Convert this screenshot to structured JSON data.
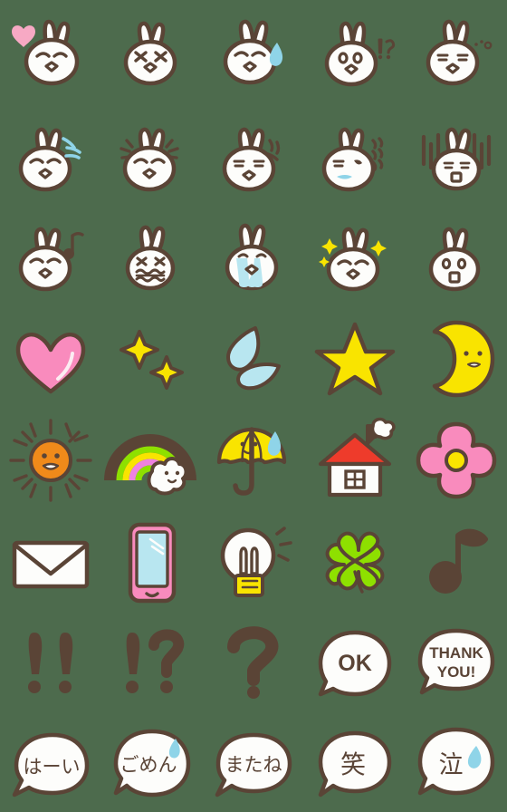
{
  "sheet": {
    "title": "Rabbit Emoji Sticker Sheet",
    "background_color": "#4d6b4d",
    "columns": 5,
    "rows": 8,
    "palette": {
      "outline": "#5a4436",
      "white": "#fdfdfb",
      "pink": "#f98bbd",
      "light_pink": "#f7a9c4",
      "yellow": "#f9e400",
      "light_blue": "#b8e6f0",
      "blue": "#8fd4e8",
      "orange": "#f08a1a",
      "red": "#ee3b2b",
      "green": "#8ee000",
      "brown": "#5a4436",
      "magenta": "#ee82e0"
    },
    "items": [
      {
        "id": "rabbit-heart",
        "label": "rabbit with heart",
        "row": 1,
        "col": 1
      },
      {
        "id": "rabbit-squint",
        "label": "rabbit squinting happy",
        "row": 1,
        "col": 2
      },
      {
        "id": "rabbit-sweat",
        "label": "rabbit with sweat drop",
        "row": 1,
        "col": 3
      },
      {
        "id": "rabbit-surprised",
        "label": "rabbit surprised",
        "row": 1,
        "col": 4,
        "mark": "!?"
      },
      {
        "id": "rabbit-sleepy",
        "label": "rabbit sleepy",
        "row": 1,
        "col": 5
      },
      {
        "id": "rabbit-splash",
        "label": "rabbit with splash",
        "row": 2,
        "col": 1
      },
      {
        "id": "rabbit-excited",
        "label": "rabbit excited lines",
        "row": 2,
        "col": 2
      },
      {
        "id": "rabbit-sparkle-side",
        "label": "rabbit with sparkles",
        "row": 2,
        "col": 3
      },
      {
        "id": "rabbit-shout",
        "label": "rabbit shouting",
        "row": 2,
        "col": 4
      },
      {
        "id": "rabbit-shock",
        "label": "rabbit shocked bars",
        "row": 2,
        "col": 5
      },
      {
        "id": "rabbit-note",
        "label": "rabbit with music note",
        "row": 3,
        "col": 1
      },
      {
        "id": "rabbit-gritted",
        "label": "rabbit gritted teeth",
        "row": 3,
        "col": 2
      },
      {
        "id": "rabbit-crying",
        "label": "rabbit crying tears",
        "row": 3,
        "col": 3
      },
      {
        "id": "rabbit-sparkly-joy",
        "label": "rabbit sparkling joy",
        "row": 3,
        "col": 4
      },
      {
        "id": "rabbit-gasp",
        "label": "rabbit gasping",
        "row": 3,
        "col": 5
      },
      {
        "id": "heart",
        "label": "pink heart",
        "row": 4,
        "col": 1
      },
      {
        "id": "sparkles",
        "label": "yellow sparkles",
        "row": 4,
        "col": 2
      },
      {
        "id": "water-drops",
        "label": "blue water drops",
        "row": 4,
        "col": 3
      },
      {
        "id": "star",
        "label": "yellow star",
        "row": 4,
        "col": 4
      },
      {
        "id": "moon",
        "label": "crescent moon face",
        "row": 4,
        "col": 5
      },
      {
        "id": "sun",
        "label": "orange sun face",
        "row": 5,
        "col": 1
      },
      {
        "id": "rainbow",
        "label": "rainbow with cloud",
        "row": 5,
        "col": 2
      },
      {
        "id": "umbrella",
        "label": "yellow umbrella face",
        "row": 5,
        "col": 3
      },
      {
        "id": "house",
        "label": "house with chimney smoke",
        "row": 5,
        "col": 4
      },
      {
        "id": "flower",
        "label": "pink flower",
        "row": 5,
        "col": 5
      },
      {
        "id": "envelope",
        "label": "white envelope",
        "row": 6,
        "col": 1
      },
      {
        "id": "smartphone",
        "label": "pink smartphone",
        "row": 6,
        "col": 2
      },
      {
        "id": "lightbulb-rabbit",
        "label": "rabbit light bulb idea",
        "row": 6,
        "col": 3
      },
      {
        "id": "clover",
        "label": "four leaf clover",
        "row": 6,
        "col": 4
      },
      {
        "id": "music-note",
        "label": "brown music note",
        "row": 6,
        "col": 5
      },
      {
        "id": "double-exclamation",
        "label": "double exclamation mark",
        "row": 7,
        "col": 1,
        "mark": "!!"
      },
      {
        "id": "interrobang",
        "label": "exclamation question mark",
        "row": 7,
        "col": 2,
        "mark": "!?"
      },
      {
        "id": "question-mark",
        "label": "question mark",
        "row": 7,
        "col": 3,
        "mark": "?"
      },
      {
        "id": "bubble-ok",
        "label": "speech bubble OK",
        "row": 7,
        "col": 4,
        "text": "OK"
      },
      {
        "id": "bubble-thankyou",
        "label": "speech bubble thank you",
        "row": 7,
        "col": 5,
        "text": "THANK YOU!",
        "line1": "THANK",
        "line2": "YOU!"
      },
      {
        "id": "bubble-hai",
        "label": "speech bubble hai",
        "row": 8,
        "col": 1,
        "text": "はーい"
      },
      {
        "id": "bubble-gomen",
        "label": "speech bubble gomen",
        "row": 8,
        "col": 2,
        "text": "ごめん"
      },
      {
        "id": "bubble-matane",
        "label": "speech bubble matane",
        "row": 8,
        "col": 3,
        "text": "またね"
      },
      {
        "id": "bubble-warai",
        "label": "speech bubble warai",
        "row": 8,
        "col": 4,
        "text": "笑"
      },
      {
        "id": "bubble-naki",
        "label": "speech bubble naki",
        "row": 8,
        "col": 5,
        "text": "泣"
      }
    ]
  }
}
